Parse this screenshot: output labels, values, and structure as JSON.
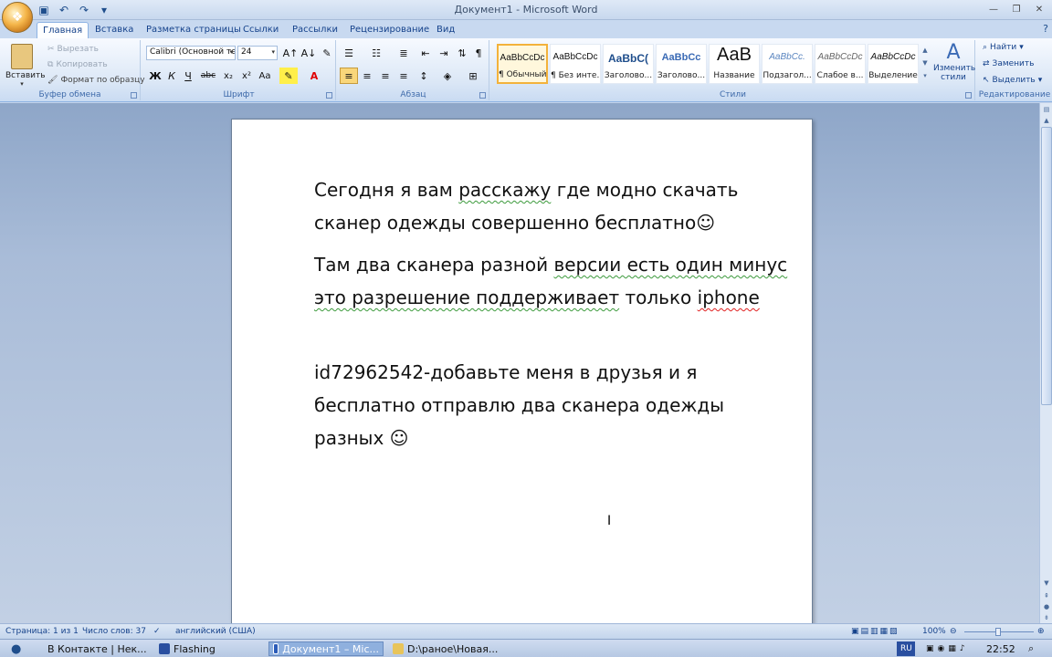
{
  "window": {
    "title": "Документ1 - Microsoft Word"
  },
  "tabs": [
    "Главная",
    "Вставка",
    "Разметка страницы",
    "Ссылки",
    "Рассылки",
    "Рецензирование",
    "Вид"
  ],
  "ribbon": {
    "clipboard": {
      "label": "Буфер обмена",
      "paste": "Вставить",
      "cut": "Вырезать",
      "copy": "Копировать",
      "format_painter": "Формат по образцу"
    },
    "font": {
      "label": "Шрифт",
      "font_name": "Calibri (Основной те",
      "font_size": "24",
      "bold": "Ж",
      "italic": "К",
      "underline": "Ч",
      "strike": "abc",
      "subscript": "x₂",
      "superscript": "x²",
      "case": "Aa",
      "font_color": "A"
    },
    "paragraph": {
      "label": "Абзац",
      "pilcrow": "¶"
    },
    "styles": {
      "label": "Стили",
      "items": [
        {
          "sample": "AaBbCcDc",
          "name": "¶ Обычный"
        },
        {
          "sample": "AaBbCcDc",
          "name": "¶ Без инте..."
        },
        {
          "sample": "AaBbC(",
          "name": "Заголово..."
        },
        {
          "sample": "AaBbCc",
          "name": "Заголово..."
        },
        {
          "sample": "АаВ",
          "name": "Название"
        },
        {
          "sample": "AaBbCc.",
          "name": "Подзагол..."
        },
        {
          "sample": "AaBbCcDc",
          "name": "Слабое в..."
        },
        {
          "sample": "AaBbCcDc",
          "name": "Выделение"
        }
      ],
      "change_styles": "Изменить стили"
    },
    "editing": {
      "label": "Редактирование",
      "find": "Найти",
      "replace": "Заменить",
      "select": "Выделить"
    }
  },
  "document": {
    "p1": "Сегодня я вам",
    "p1_sq": "расскажу",
    "p1_rest": "где модно скачать сканер одежды совершенно бесплатно☺",
    "p2_a": "Там два сканера разной",
    "p2_sq1": "версии есть один минус это разрешение поддерживает",
    "p2_b": "только",
    "p2_sq2": "iphone",
    "p3": "id72962542-добавьте меня в друзья и я бесплатно отправлю два сканера одежды разных ☺"
  },
  "status": {
    "page": "Страница: 1 из 1",
    "words": "Число слов: 37",
    "language": "английский (США)",
    "zoom": "100%"
  },
  "taskbar": {
    "items": [
      "В Контакте | Нек...",
      "Flashing",
      "Документ1 – Mic...",
      "D:\\ранoe\\Новая..."
    ],
    "lang": "RU",
    "time": "22:52"
  },
  "colors": {
    "ribbon_blue": "#15428b",
    "active_style": "#f3b23b",
    "grammar_squiggle": "#3c9a3c",
    "spell_squiggle": "#e02020"
  }
}
